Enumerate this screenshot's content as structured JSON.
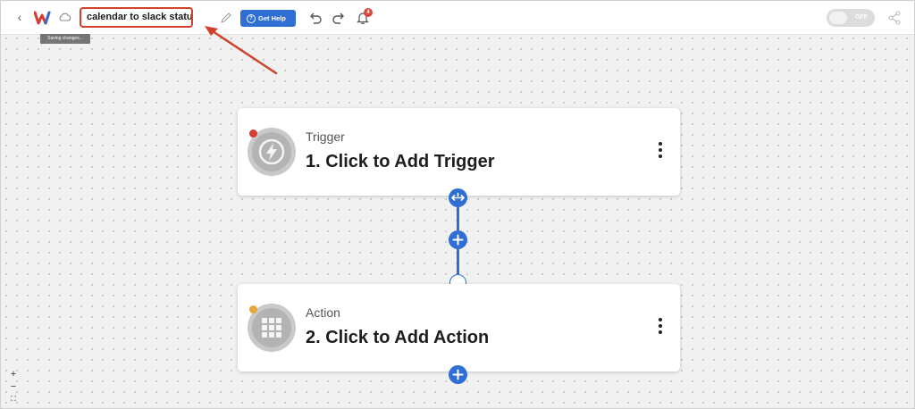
{
  "topbar": {
    "workflow_name": "calendar to slack status",
    "saving_tooltip": "Saving changes...",
    "help_label": "Get Help",
    "help_icon_glyph": "?",
    "notification_count": "4",
    "toggle_label": "OFF"
  },
  "canvas": {
    "trigger": {
      "type_label": "Trigger",
      "title": "1. Click to Add Trigger",
      "status_color": "#d63b2f"
    },
    "action": {
      "type_label": "Action",
      "title": "2. Click to Add Action",
      "status_color": "#e8a93a"
    }
  },
  "zoom": {
    "in": "+",
    "out": "−",
    "fit": "⛶"
  },
  "colors": {
    "accent": "#2f6fd4",
    "annotation": "#d0422a"
  }
}
